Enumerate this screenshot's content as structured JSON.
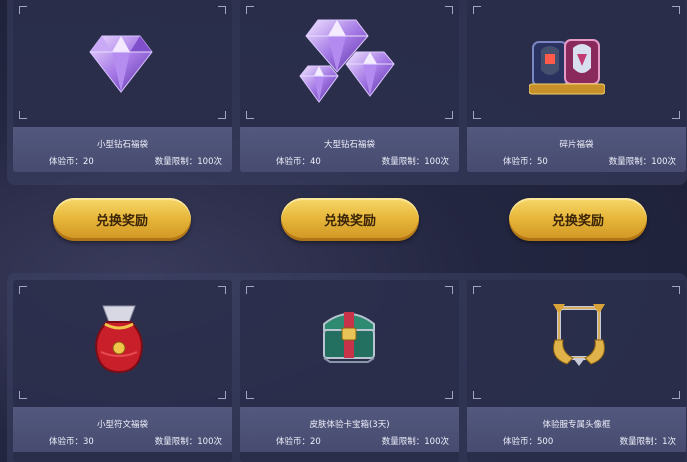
{
  "cards": [
    {
      "name": "小型钻石福袋",
      "coin_label": "体验币：",
      "coin": "20",
      "limit_label": "数量限制：",
      "limit": "100次",
      "icon": "small-diamond-icon"
    },
    {
      "name": "大型钻石福袋",
      "coin_label": "体验币：",
      "coin": "40",
      "limit_label": "数量限制：",
      "limit": "100次",
      "icon": "large-diamond-icon"
    },
    {
      "name": "碎片福袋",
      "coin_label": "体验币：",
      "coin": "50",
      "limit_label": "数量限制：",
      "limit": "100次",
      "icon": "fragment-icon"
    },
    {
      "name": "小型符文福袋",
      "coin_label": "体验币：",
      "coin": "30",
      "limit_label": "数量限制：",
      "limit": "100次",
      "icon": "rune-bag-icon"
    },
    {
      "name": "皮肤体验卡宝箱(3天)",
      "coin_label": "体验币：",
      "coin": "20",
      "limit_label": "数量限制：",
      "limit": "100次",
      "icon": "treasure-chest-icon"
    },
    {
      "name": "体验服专属头像框",
      "coin_label": "体验币：",
      "coin": "500",
      "limit_label": "数量限制：",
      "limit": "1次",
      "icon": "avatar-frame-icon"
    }
  ],
  "buttons": [
    {
      "label": "兑换奖励"
    },
    {
      "label": "兑换奖励"
    },
    {
      "label": "兑换奖励"
    }
  ],
  "colors": {
    "background": "#232640",
    "panel": "#3c4264",
    "info_bar": "#4e5378",
    "button_gold": "#e8b83b",
    "button_text": "#3b2408"
  }
}
